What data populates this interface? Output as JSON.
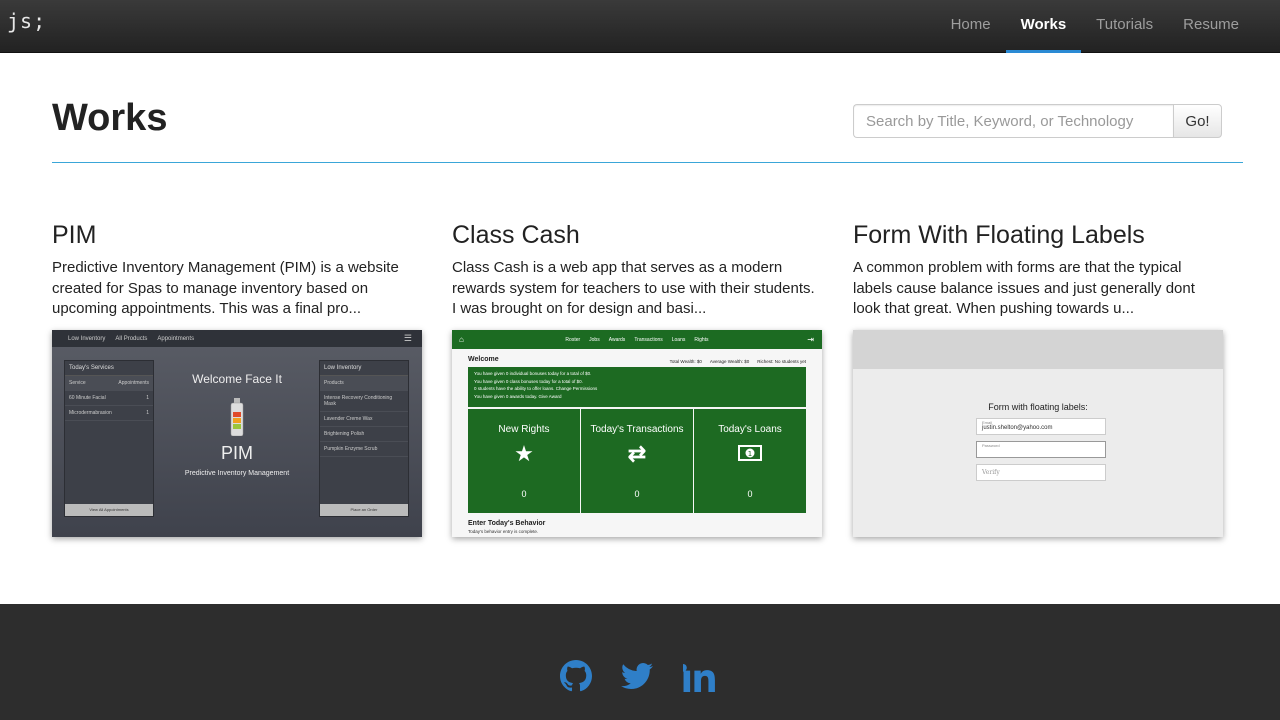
{
  "nav": {
    "brand": "js;",
    "items": [
      {
        "label": "Home"
      },
      {
        "label": "Works"
      },
      {
        "label": "Tutorials"
      },
      {
        "label": "Resume"
      }
    ]
  },
  "header": {
    "title": "Works",
    "search_placeholder": "Search by Title, Keyword, or Technology",
    "search_button": "Go!"
  },
  "projects": [
    {
      "title": "PIM",
      "description": "Predictive Inventory Management (PIM) is a website created for Spas to manage inventory based on upcoming appointments. This was a final pro...",
      "preview": {
        "tabs": [
          "Low Inventory",
          "All Products",
          "Appointments"
        ],
        "left_panel": {
          "header": "Today's Services",
          "col1": "Service",
          "col2": "Appointments",
          "rows": [
            {
              "name": "60 Minute Facial",
              "count": "1"
            },
            {
              "name": "Microdermabrasion",
              "count": "1"
            }
          ],
          "footer": "View All Appointments"
        },
        "right_panel": {
          "header": "Low Inventory",
          "rows": [
            "Products",
            "Intense Recovery Conditioning Mask",
            "Lavender Creme Wax",
            "Brightening Polish",
            "Pumpkin Enzyme Scrub"
          ],
          "footer": "Place an Order"
        },
        "welcome": "Welcome Face It",
        "logo": "PIM",
        "subtitle": "Predictive Inventory Management"
      }
    },
    {
      "title": "Class Cash",
      "description": "Class Cash is a web app that serves as a modern rewards system for teachers to use with their students. I was brought on for design and basi...",
      "preview": {
        "nav": [
          "Roster",
          "Jobs",
          "Awards",
          "Transactions",
          "Loans",
          "Rights"
        ],
        "welcome": "Welcome",
        "stats": [
          "Total Wealth: $0",
          "Average Wealth: $0",
          "Richest: No students yet"
        ],
        "alerts": [
          "You have given 0 individual bonuses today for a total of $0.",
          "You have given 0 class bonuses today for a total of $0.",
          "0 students have the ability to offer loans. Change Permissions",
          "You have given 0 awards today. Give Award"
        ],
        "tiles": [
          {
            "label": "New Rights",
            "value": "0"
          },
          {
            "label": "Today's Transactions",
            "value": "0"
          },
          {
            "label": "Today's Loans",
            "value": "0"
          }
        ],
        "behavior_title": "Enter Today's Behavior",
        "behavior_note": "Today's behavior entry is complete."
      }
    },
    {
      "title": "Form With Floating Labels",
      "description": "A common problem with forms are that the typical labels cause balance issues and just generally dont look that great. When pushing towards u...",
      "preview": {
        "heading": "Form with floating labels:",
        "email_label": "Email",
        "email_value": "justin.shelton@yahoo.com",
        "password_label": "Password",
        "verify_placeholder": "Verify"
      }
    }
  ],
  "colors": {
    "accent": "#2a8ad4",
    "rule": "#3aa6d8",
    "footer": "#2d2d2d",
    "social": "#2f7fc8",
    "classcash_green": "#1d6a22"
  },
  "footer": {
    "icons": [
      "github-icon",
      "twitter-icon",
      "linkedin-icon"
    ]
  }
}
